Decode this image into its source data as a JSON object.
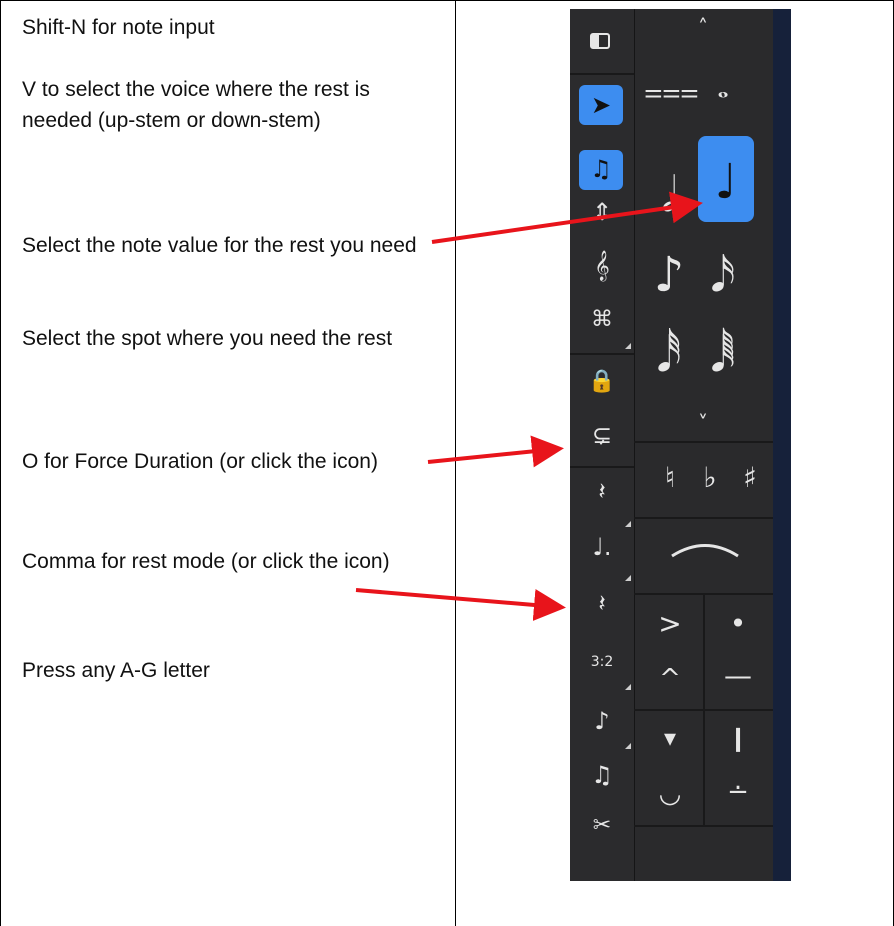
{
  "instructions": [
    "Shift-N for note input",
    "V to select the voice where the rest is needed (up-stem or down-stem)",
    "Select the note value for the rest you need",
    "Select the spot where you need the rest",
    "O for Force Duration (or click the icon)",
    "Comma for rest mode (or click the icon)",
    "Press any A-G letter"
  ],
  "toolbar": {
    "left_tools": [
      "panel-toggle-icon",
      "select-arrow-icon",
      "note-input-icon",
      "flip-direction-icon",
      "chord-icon",
      "voice-icon",
      "lock-icon",
      "force-duration-icon",
      "quarter-rest-icon",
      "dotted-note-icon",
      "rest-mode-icon",
      "tuplet-icon",
      "grace-note-icon",
      "tie-notes-icon",
      "cut-icon"
    ],
    "tuplet_label": "3:2",
    "durations": [
      "breve",
      "whole",
      "half",
      "quarter",
      "eighth",
      "sixteenth",
      "thirty-second",
      "sixty-fourth"
    ],
    "selected_duration": "quarter",
    "accidentals": [
      "♮",
      "♭",
      "♯"
    ],
    "articulations": [
      "accent",
      "staccato",
      "marcato",
      "tenuto",
      "staccatissimo",
      "wedge",
      "fermata",
      "tenuto-staccato"
    ],
    "colors": {
      "panel": "#2a2a2c",
      "selected": "#3d8df0",
      "edge": "#16213a",
      "arrow": "#e8141b"
    }
  }
}
